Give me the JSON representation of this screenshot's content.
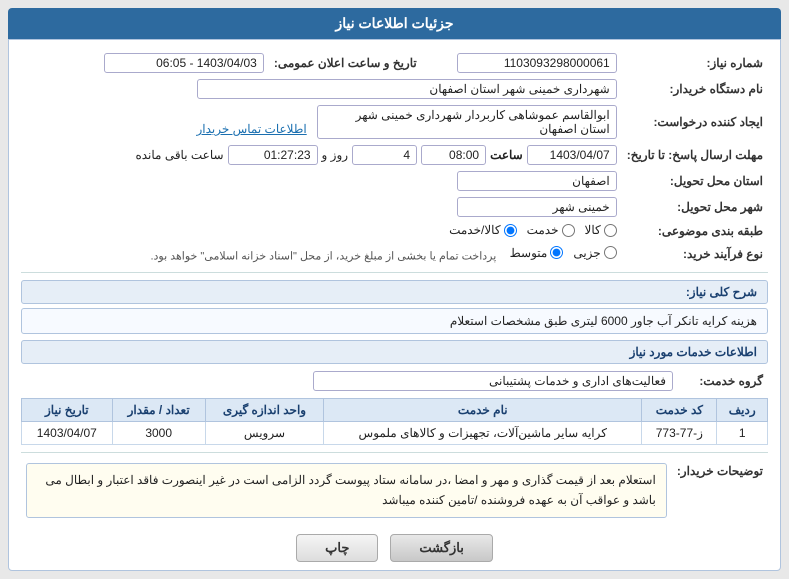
{
  "header": {
    "title": "جزئیات اطلاعات نیاز"
  },
  "fields": {
    "shomare_niaz_label": "شماره نیاز:",
    "shomare_niaz_value": "1103093298000061",
    "nam_dastgah_label": "نام دستگاه خریدار:",
    "nam_dastgah_value": "شهرداری خمینی شهر استان اصفهان",
    "ijad_label": "ایجاد کننده درخواست:",
    "ijad_value": "ابوالقاسم عموشاهی کاربردار شهرداری خمینی شهر استان اصفهان",
    "etelaat_tamas_link": "اطلاعات تماس خریدار",
    "mohlet_label": "مهلت ارسال پاسخ: تا تاریخ:",
    "date_value": "1403/04/07",
    "time_value": "08:00",
    "roz_value": "4",
    "roz_label": "روز و",
    "remaining_value": "01:27:23",
    "remaining_label": "ساعت باقی مانده",
    "ostan_label": "استان محل تحویل:",
    "ostan_value": "اصفهان",
    "shahr_label": "شهر محل تحویل:",
    "shahr_value": "خمینی شهر",
    "tarighe_label": "طبقه بندی موضوعی:",
    "kala_label": "کالا",
    "khadamat_label": "خدمت",
    "kala_khadamat_label": "کالا/خدمت",
    "tarikh_ilan_label": "تاریخ و ساعت اعلان عمومی:",
    "tarikh_ilan_value": "1403/04/03 - 06:05",
    "nou_farayand_label": "نوع فرآیند خرید:",
    "jazii_label": "جزیی",
    "motavaset_label": "متوسط",
    "pardakht_label": "پرداخت تمام یا بخشی از مبلغ خرید، از محل \"اسناد خزانه اسلامی\" خواهد بود."
  },
  "sarh_section": {
    "title": "شرح کلی نیاز:",
    "value": "هزینه کرایه تانکر آب جاور 6000 لیتری طبق مشخصات استعلام"
  },
  "etelaat_section": {
    "title": "اطلاعات خدمات مورد نیاز"
  },
  "group_khadamat": {
    "label": "گروه خدمت:",
    "value": "فعالیت‌های اداری و خدمات پشتیبانی"
  },
  "services_table": {
    "headers": [
      "ردیف",
      "کد خدمت",
      "نام خدمت",
      "واحد اندازه گیری",
      "تعداد / مقدار",
      "تاریخ نیاز"
    ],
    "rows": [
      {
        "radif": "1",
        "kod": "ز-77-773",
        "nam": "کرایه سایر ماشین‌آلات، تجهیزات و کالاهای ملموس",
        "vahed": "سرویس",
        "tedad": "3000",
        "tarikh": "1403/04/07"
      }
    ]
  },
  "notes": {
    "label": "توضیحات خریدار:",
    "value": "استعلام بعد از قیمت گذاری و مهر و امضا ،در سامانه ستاد پیوست گردد الزامی است در غیر اینصورت فاقد اعتبار و ابطال می باشد و عواقب آن به عهده فروشنده /تامین کننده میباشد"
  },
  "buttons": {
    "back_label": "بازگشت",
    "print_label": "چاپ"
  }
}
